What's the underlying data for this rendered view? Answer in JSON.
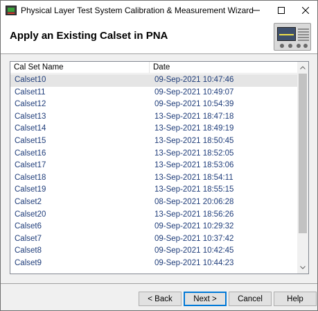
{
  "window": {
    "title": "Physical Layer Test System Calibration & Measurement Wizard"
  },
  "header": {
    "title": "Apply an Existing Calset in PNA"
  },
  "list": {
    "columns": [
      "Cal Set Name",
      "Date"
    ],
    "rows": [
      {
        "name": "Calset10",
        "date": "09-Sep-2021 10:47:46",
        "selected": true
      },
      {
        "name": "Calset11",
        "date": "09-Sep-2021 10:49:07"
      },
      {
        "name": "Calset12",
        "date": "09-Sep-2021 10:54:39"
      },
      {
        "name": "Calset13",
        "date": "13-Sep-2021 18:47:18"
      },
      {
        "name": "Calset14",
        "date": "13-Sep-2021 18:49:19"
      },
      {
        "name": "Calset15",
        "date": "13-Sep-2021 18:50:45"
      },
      {
        "name": "Calset16",
        "date": "13-Sep-2021 18:52:05"
      },
      {
        "name": "Calset17",
        "date": "13-Sep-2021 18:53:06"
      },
      {
        "name": "Calset18",
        "date": "13-Sep-2021 18:54:11"
      },
      {
        "name": "Calset19",
        "date": "13-Sep-2021 18:55:15"
      },
      {
        "name": "Calset2",
        "date": "08-Sep-2021 20:06:28"
      },
      {
        "name": "Calset20",
        "date": "13-Sep-2021 18:56:26"
      },
      {
        "name": "Calset6",
        "date": "09-Sep-2021 10:29:32"
      },
      {
        "name": "Calset7",
        "date": "09-Sep-2021 10:37:42"
      },
      {
        "name": "Calset8",
        "date": "09-Sep-2021 10:42:45"
      },
      {
        "name": "Calset9",
        "date": "09-Sep-2021 10:44:23"
      }
    ]
  },
  "buttons": {
    "back": "< Back",
    "next": "Next >",
    "cancel": "Cancel",
    "help": "Help"
  },
  "colors": {
    "row_text": "#1f3d7a",
    "selected_row": "#e5e5e5",
    "default_button_border": "#0078d7"
  },
  "icons": [
    "app-icon",
    "minimize-icon",
    "maximize-icon",
    "close-icon",
    "pna-instrument-image",
    "scroll-up-icon",
    "scroll-down-icon"
  ]
}
